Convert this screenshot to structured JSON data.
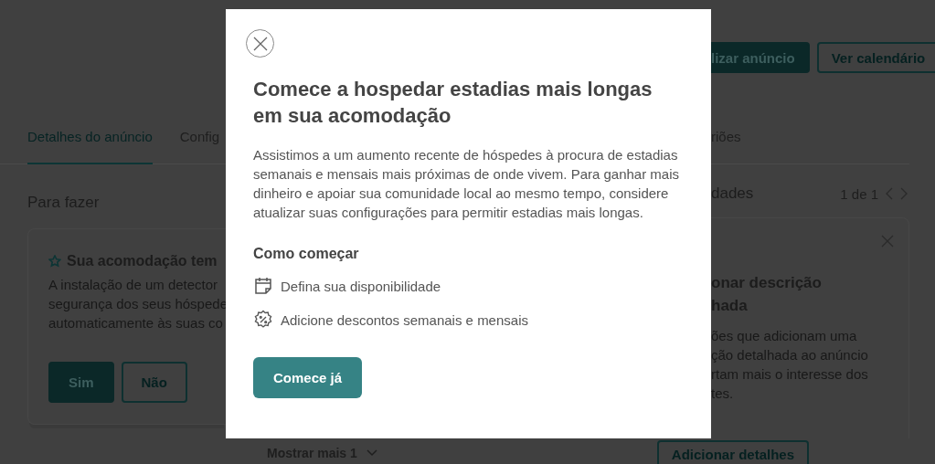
{
  "background": {
    "header_buttons": [
      {
        "label": "lizar anúncio",
        "kind": "primary"
      },
      {
        "label": "Ver calendário",
        "kind": "secondary"
      }
    ],
    "tabs": [
      {
        "label": "Detalhes do anúncio",
        "selected": true
      },
      {
        "label": "Config",
        "selected": false
      },
      {
        "label": "riões",
        "selected": false
      }
    ],
    "todo": {
      "title": "Para fazer",
      "card": {
        "title": "Sua acomodação tem",
        "lines": [
          "A instalação de um detector",
          "segurança dos seus hóspede",
          "automaticamente às suas co"
        ],
        "buttons": [
          {
            "label": "Sim",
            "kind": "primary"
          },
          {
            "label": "Não",
            "kind": "secondary"
          }
        ]
      },
      "show_more": "Mostrar mais 1"
    },
    "opportunities": {
      "title": "dades",
      "pager": "1 de 1",
      "card": {
        "title_lines": [
          "onar descrição",
          "hada"
        ],
        "lines": [
          "ões que adicionam uma",
          "ção detalhada ao anúncio",
          "rtam mais o interesse dos",
          "tes."
        ],
        "button": "Adicionar detalhes"
      }
    }
  },
  "modal": {
    "title": "Comece a hospedar estadias mais longas em sua acomodação",
    "body": "Assistimos a um aumento recente de hóspedes à procura de estadias semanais e mensais mais próximas de onde vivem. Para ganhar mais dinheiro e apoiar sua comunidade local ao mesmo tempo, considere atualizar suas configurações para permitir estadias mais longas.",
    "section_title": "Como começar",
    "steps": [
      {
        "kind": "calendar",
        "text": "Defina sua disponibilidade"
      },
      {
        "kind": "discount",
        "text": "Adicione descontos semanais e mensais"
      }
    ],
    "button": "Comece já"
  }
}
